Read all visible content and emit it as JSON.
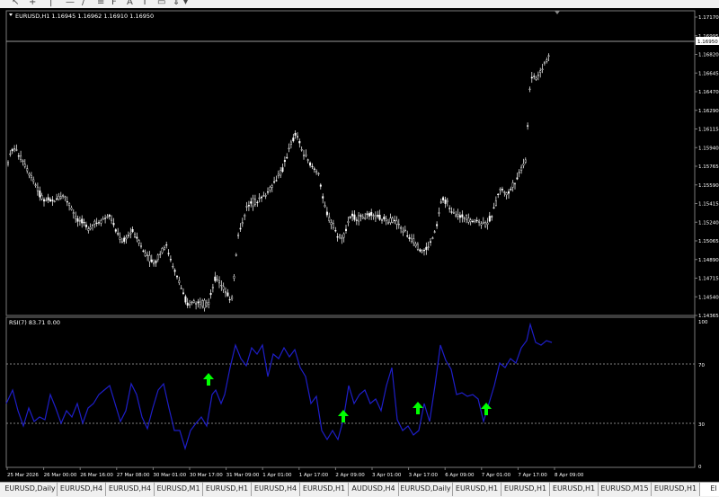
{
  "toolbar": {
    "icons": [
      "cursor-icon",
      "crosshair-icon",
      "vertical-line-icon",
      "trendline-icon",
      "channel-icon",
      "fibonacci-icon",
      "text-icon",
      "label-icon",
      "arrows-icon"
    ],
    "text_tool_label": "A"
  },
  "main_chart": {
    "header": "EURUSD,H1  1.16945 1.16962 1.16910 1.16950",
    "current_price": "1.16950",
    "price_labels": [
      "1.17170",
      "1.16995",
      "1.16820",
      "1.16645",
      "1.16470",
      "1.16290",
      "1.16115",
      "1.15940",
      "1.15765",
      "1.15590",
      "1.15415",
      "1.15240",
      "1.15065",
      "1.14890",
      "1.14715",
      "1.14540",
      "1.14365"
    ]
  },
  "rsi": {
    "header": "RSI(7)         83.71  0.00",
    "levels": [
      "100",
      "70",
      "30",
      "0"
    ]
  },
  "time_labels": [
    "25 Mar 2026",
    "26 Mar 00:00",
    "26 Mar 16:00",
    "27 Mar 08:00",
    "30 Mar 01:00",
    "30 Mar 17:00",
    "31 Mar 09:00",
    "1 Apr 01:00",
    "1 Apr 17:00",
    "2 Apr 09:00",
    "3 Apr 01:00",
    "3 Apr 17:00",
    "6 Apr 09:00",
    "7 Apr 01:00",
    "7 Apr 17:00",
    "8 Apr 09:00"
  ],
  "tabs": [
    "EURUSD,Daily",
    "EURUSD,H4",
    "EURUSD,H4",
    "EURUSD,M1",
    "EURUSD,H1",
    "EURUSD,H4",
    "EURUSD,H1",
    "AUDUSD,H4",
    "EURUSD,Daily",
    "EURUSD,H1",
    "EURUSD,H1",
    "EURUSD,H1",
    "EURUSD,M15",
    "EURUSD,H1",
    "El"
  ],
  "colors": {
    "background": "#000000",
    "candles": "#ffffff",
    "rsi_line": "#1e1ec8",
    "signal_arrows": "#00ff00",
    "grid": "#808080"
  }
}
